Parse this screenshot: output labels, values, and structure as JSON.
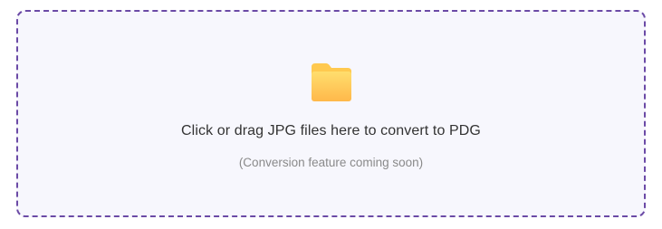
{
  "dropzone": {
    "icon": "folder-icon",
    "message": "Click or drag JPG files here to convert to PDG",
    "note": "(Conversion feature coming soon)"
  },
  "colors": {
    "border": "#6b4aa6",
    "background": "#f7f7fd",
    "folder_light": "#ffd866",
    "folder_dark": "#ffb845",
    "message": "#333333",
    "note": "#8a8a8a"
  }
}
